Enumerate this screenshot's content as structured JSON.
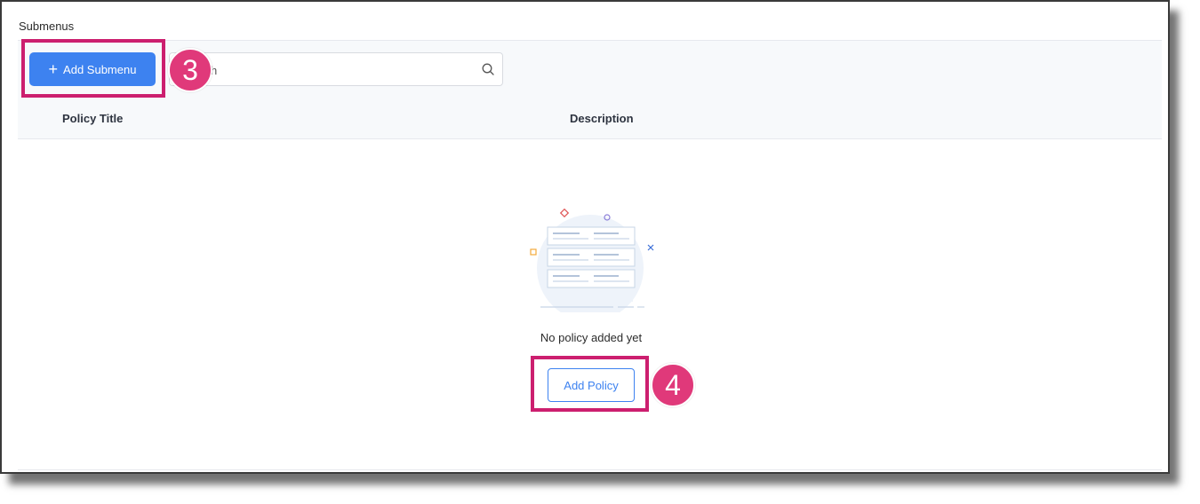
{
  "section": {
    "title": "Submenus"
  },
  "toolbar": {
    "add_button_label": "Add Submenu",
    "search_value": "Search",
    "search_icon": "search-icon"
  },
  "table": {
    "columns": [
      "Policy Title",
      "Description"
    ]
  },
  "empty_state": {
    "message": "No policy added yet",
    "button_label": "Add Policy"
  },
  "annotations": {
    "step_a": "3",
    "step_b": "4",
    "highlight_color": "#cc1f6f",
    "badge_color": "#e0397a"
  },
  "colors": {
    "primary": "#3d82f0"
  }
}
